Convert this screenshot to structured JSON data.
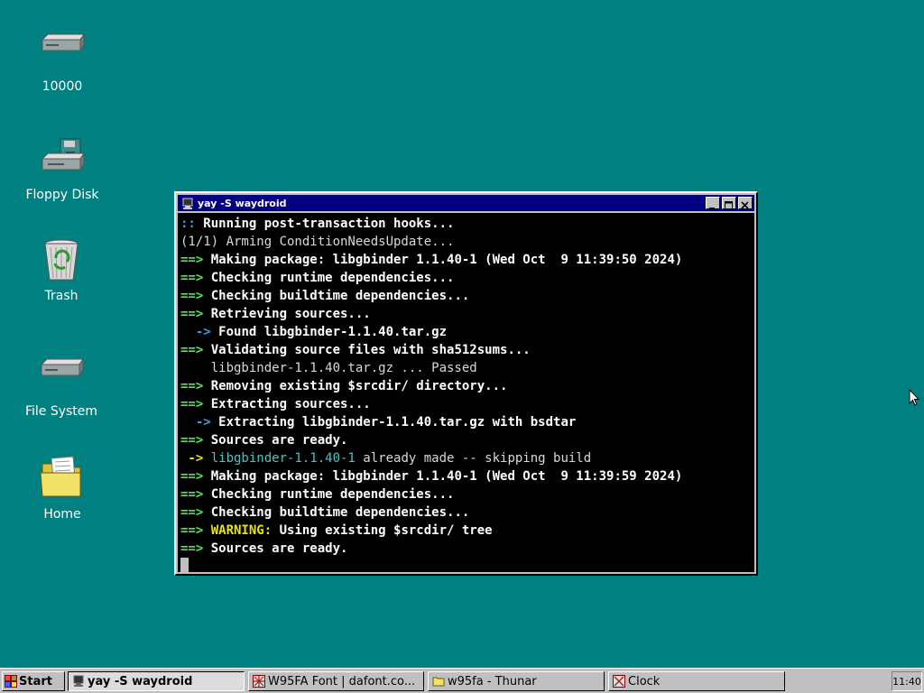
{
  "desktop": {
    "icons": [
      {
        "label": "10000",
        "icon": "drive-icon"
      },
      {
        "label": "Floppy Disk",
        "icon": "floppy-drive-icon"
      },
      {
        "label": "Trash",
        "icon": "trash-icon"
      },
      {
        "label": "File System",
        "icon": "drive-icon"
      },
      {
        "label": "Home",
        "icon": "folder-icon"
      }
    ]
  },
  "window": {
    "title": "yay -S waydroid",
    "buttons": [
      "minimize",
      "maximize",
      "close"
    ],
    "terminal_lines": [
      [
        {
          "t": ":: ",
          "c": "bl"
        },
        {
          "t": "Running post-transaction hooks...",
          "c": "b"
        }
      ],
      [
        {
          "t": "(1/1) Arming ConditionNeedsUpdate...",
          "c": ""
        }
      ],
      [
        {
          "t": "==> ",
          "c": "g"
        },
        {
          "t": "Making package: libgbinder 1.1.40-1 (Wed Oct  9 11:39:50 2024)",
          "c": "b"
        }
      ],
      [
        {
          "t": "==> ",
          "c": "g"
        },
        {
          "t": "Checking runtime dependencies...",
          "c": "b"
        }
      ],
      [
        {
          "t": "==> ",
          "c": "g"
        },
        {
          "t": "Checking buildtime dependencies...",
          "c": "b"
        }
      ],
      [
        {
          "t": "==> ",
          "c": "g"
        },
        {
          "t": "Retrieving sources...",
          "c": "b"
        }
      ],
      [
        {
          "t": "  -> ",
          "c": "bl"
        },
        {
          "t": "Found libgbinder-1.1.40.tar.gz",
          "c": "b"
        }
      ],
      [
        {
          "t": "==> ",
          "c": "g"
        },
        {
          "t": "Validating source files with sha512sums...",
          "c": "b"
        }
      ],
      [
        {
          "t": "    libgbinder-1.1.40.tar.gz ... Passed",
          "c": ""
        }
      ],
      [
        {
          "t": "==> ",
          "c": "g"
        },
        {
          "t": "Removing existing $srcdir/ directory...",
          "c": "b"
        }
      ],
      [
        {
          "t": "==> ",
          "c": "g"
        },
        {
          "t": "Extracting sources...",
          "c": "b"
        }
      ],
      [
        {
          "t": "  -> ",
          "c": "bl"
        },
        {
          "t": "Extracting libgbinder-1.1.40.tar.gz with bsdtar",
          "c": "b"
        }
      ],
      [
        {
          "t": "==> ",
          "c": "g"
        },
        {
          "t": "Sources are ready.",
          "c": "b"
        }
      ],
      [
        {
          "t": " -> ",
          "c": "y"
        },
        {
          "t": "libgbinder-1.1.40-1",
          "c": "cy"
        },
        {
          "t": " already made -- skipping build",
          "c": ""
        }
      ],
      [
        {
          "t": "==> ",
          "c": "g"
        },
        {
          "t": "Making package: libgbinder 1.1.40-1 (Wed Oct  9 11:39:59 2024)",
          "c": "b"
        }
      ],
      [
        {
          "t": "==> ",
          "c": "g"
        },
        {
          "t": "Checking runtime dependencies...",
          "c": "b"
        }
      ],
      [
        {
          "t": "==> ",
          "c": "g"
        },
        {
          "t": "Checking buildtime dependencies...",
          "c": "b"
        }
      ],
      [
        {
          "t": "==> ",
          "c": "g"
        },
        {
          "t": "WARNING: ",
          "c": "y"
        },
        {
          "t": "Using existing $srcdir/ tree",
          "c": "b"
        }
      ],
      [
        {
          "t": "==> ",
          "c": "g"
        },
        {
          "t": "Sources are ready.",
          "c": "b"
        }
      ]
    ]
  },
  "taskbar": {
    "start_label": "Start",
    "tasks": [
      {
        "label": "yay -S waydroid",
        "icon": "terminal-icon",
        "active": true
      },
      {
        "label": "W95FA Font | dafont.co...",
        "icon": "browser-icon",
        "active": false
      },
      {
        "label": "w95fa - Thunar",
        "icon": "folder-icon",
        "active": false
      },
      {
        "label": "Clock",
        "icon": "clock-icon",
        "active": false
      }
    ],
    "clock": "11:40"
  },
  "colors": {
    "desktop": "#008080",
    "titlebar": "#000080",
    "terminal_bg": "#000000",
    "arrow_green": "#4fe84f",
    "arrow_blue": "#3d9bdc",
    "warning_yellow": "#e6e600"
  }
}
